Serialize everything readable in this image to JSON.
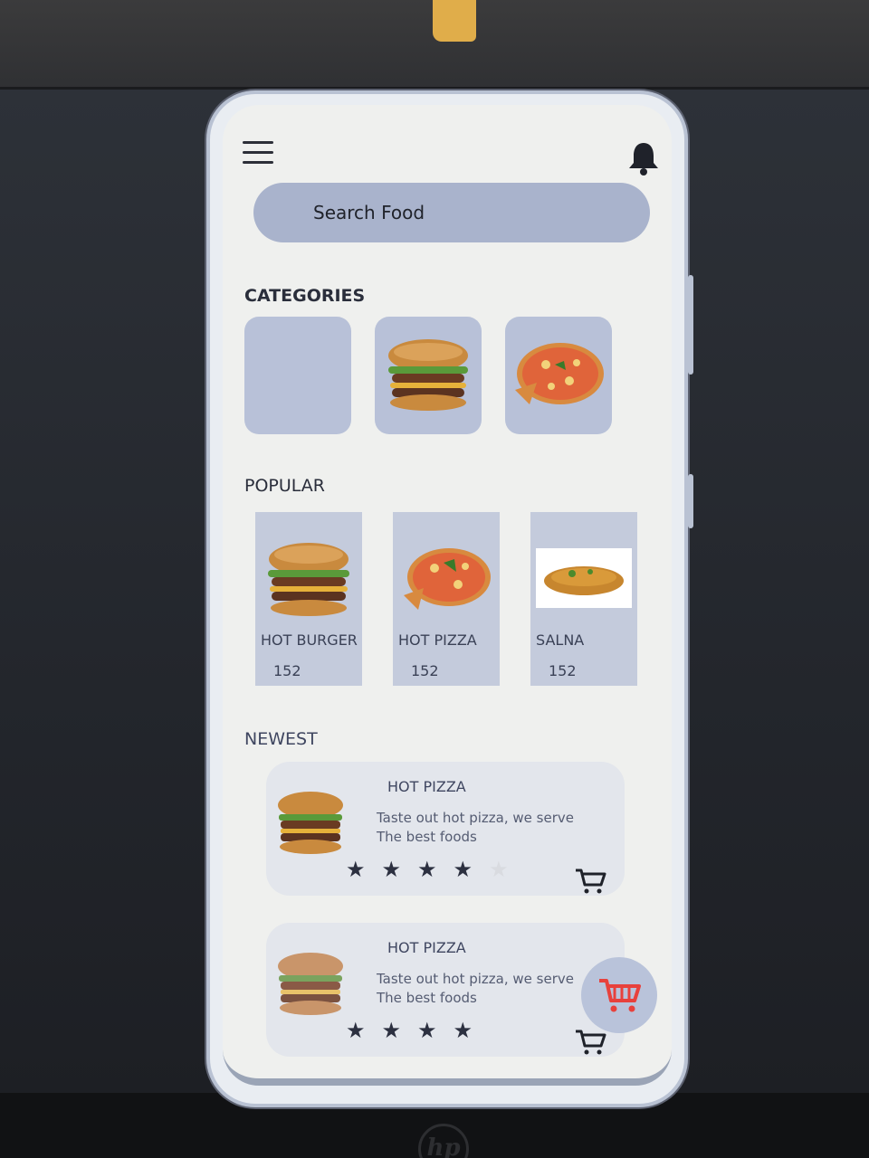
{
  "search": {
    "label": "Search Food"
  },
  "sections": {
    "categories": "CATEGORIES",
    "popular": "POPULAR",
    "newest": "NEWEST"
  },
  "categories": [
    {
      "name": "",
      "image": "empty"
    },
    {
      "name": "",
      "image": "burger-icon"
    },
    {
      "name": "",
      "image": "pizza-icon"
    }
  ],
  "popular": [
    {
      "name": "HOT BURGER",
      "count": "152",
      "image": "burger-icon"
    },
    {
      "name": "HOT PIZZA",
      "count": "152",
      "image": "pizza-icon"
    },
    {
      "name": "SALNA",
      "count": "152",
      "image": "curry-icon"
    }
  ],
  "newest": [
    {
      "title": "HOT PIZZA",
      "description": "Taste out hot pizza, we serve The best foods",
      "rating": 4,
      "image": "burger-icon"
    },
    {
      "title": "HOT PIZZA",
      "description": "Taste out hot pizza, we serve The best foods",
      "rating": 4,
      "image": "burger-icon"
    }
  ],
  "colors": {
    "accent": "#a9b3cc",
    "card": "#c4cbdc",
    "fab_cart": "#e8413c",
    "text": "#2a2e3b"
  }
}
